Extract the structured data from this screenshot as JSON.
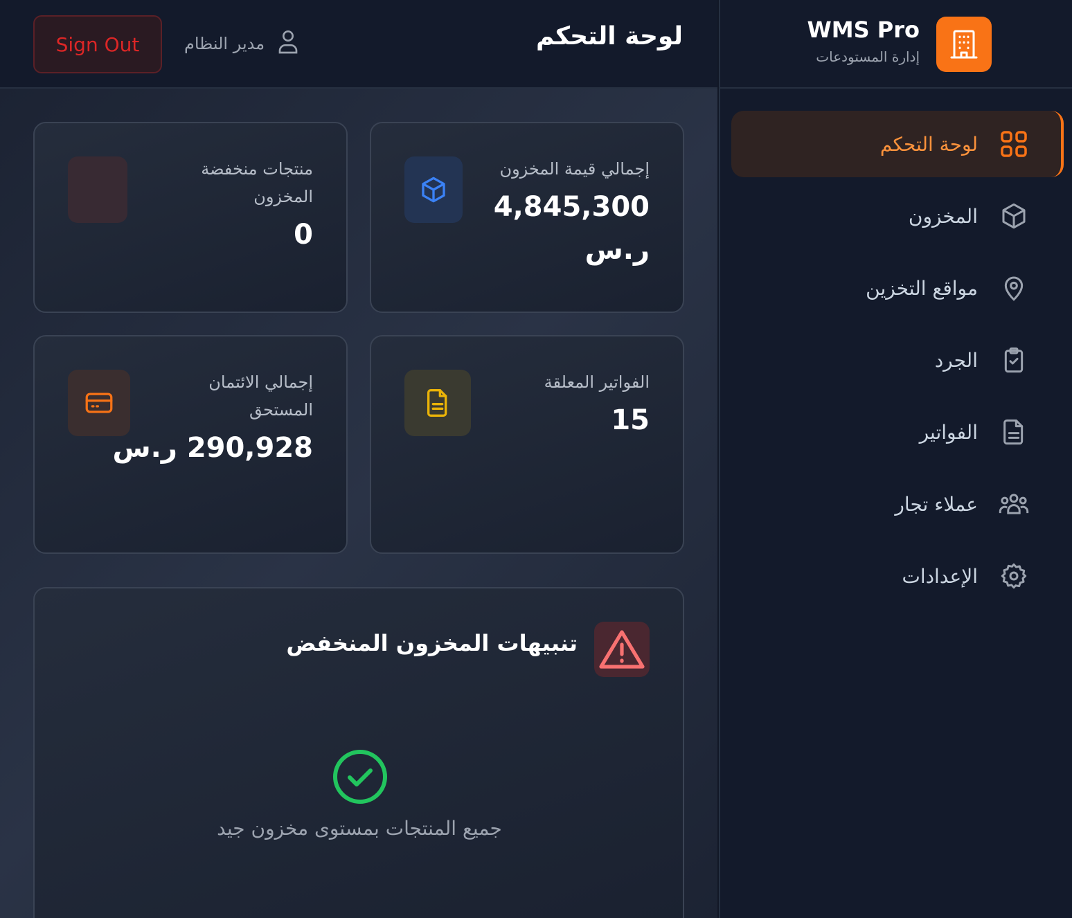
{
  "brand": {
    "title": "WMS Pro",
    "subtitle": "إدارة المستودعات",
    "logo_icon": "building-icon",
    "accent": "#f97316"
  },
  "header": {
    "title": "لوحة التحكم",
    "user_name": "مدير النظام",
    "user_icon": "user-icon",
    "sign_out": "Sign Out"
  },
  "sidebar": {
    "items": [
      {
        "label": "لوحة التحكم",
        "icon": "dashboard-grid-icon",
        "active": true
      },
      {
        "label": "المخزون",
        "icon": "box-icon",
        "active": false
      },
      {
        "label": "مواقع التخزين",
        "icon": "location-pin-icon",
        "active": false
      },
      {
        "label": "الجرد",
        "icon": "clipboard-check-icon",
        "active": false
      },
      {
        "label": "الفواتير",
        "icon": "document-icon",
        "active": false
      },
      {
        "label": "عملاء تجار",
        "icon": "users-icon",
        "active": false
      },
      {
        "label": "الإعدادات",
        "icon": "gear-icon",
        "active": false
      }
    ]
  },
  "stats": {
    "inventory_value": {
      "label": "إجمالي قيمة المخزون",
      "value": "4,845,300",
      "currency": "ر.س",
      "icon": "box-icon",
      "color": "#3b82f6"
    },
    "low_stock": {
      "label_line1": "منتجات منخفضة",
      "label_line2": "المخزون",
      "value": "0",
      "color": "#ef4444"
    },
    "pending_invoices": {
      "label": "الفواتير المعلقة",
      "value": "15",
      "icon": "document-icon",
      "color": "#eab308"
    },
    "credit_due": {
      "label_line1": "إجمالي الائتمان",
      "label_line2": "المستحق",
      "value": "290,928 ر.س",
      "icon": "credit-card-icon",
      "color": "#f97316"
    }
  },
  "alerts": {
    "title": "تنبيهات المخزون المنخفض",
    "icon": "warning-triangle-icon",
    "empty_icon": "check-circle-icon",
    "empty_text": "جميع المنتجات بمستوى مخزون جيد"
  }
}
